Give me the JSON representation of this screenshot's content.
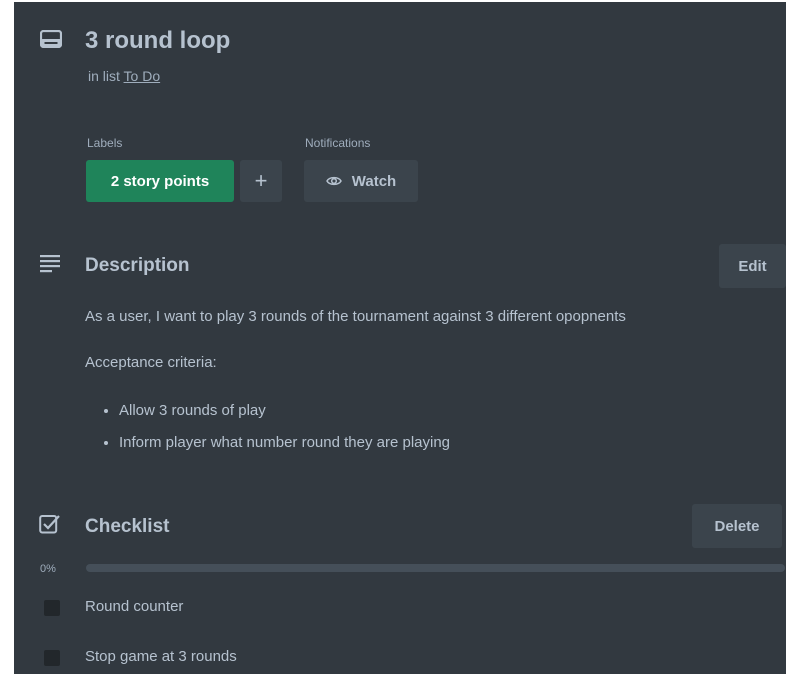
{
  "card": {
    "title": "3 round loop",
    "in_list_prefix": "in list",
    "list_name": "To Do"
  },
  "labels": {
    "heading": "Labels",
    "items": [
      "2 story points"
    ],
    "add_symbol": "+",
    "label_color": "#1f845a"
  },
  "notifications": {
    "heading": "Notifications",
    "watch_label": "Watch"
  },
  "description": {
    "title": "Description",
    "edit_label": "Edit",
    "paragraphs": [
      "As a user, I want to play 3 rounds of the tournament against 3 different opopnents",
      "Acceptance criteria:"
    ],
    "bullets": [
      "Allow 3 rounds of play",
      "Inform player what number round they are playing"
    ]
  },
  "checklist": {
    "title": "Checklist",
    "delete_label": "Delete",
    "progress_text": "0%",
    "progress_fraction": 0,
    "items": [
      {
        "text": "Round counter",
        "checked": false
      },
      {
        "text": "Stop game at 3 rounds",
        "checked": false
      }
    ]
  },
  "icons": {
    "card": "card-icon",
    "description": "description-icon",
    "checklist": "checklist-icon",
    "watch": "eye-icon"
  }
}
